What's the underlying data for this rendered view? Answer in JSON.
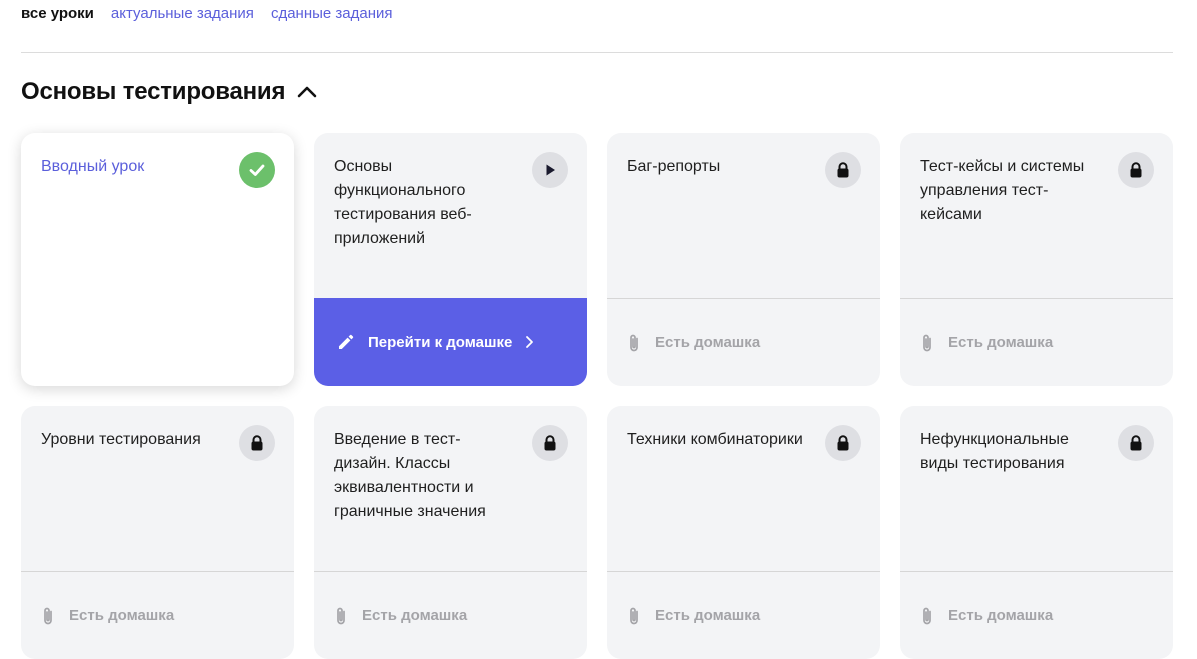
{
  "tabs": [
    {
      "label": "все уроки",
      "active": true
    },
    {
      "label": "актуальные задания",
      "active": false
    },
    {
      "label": "сданные задания",
      "active": false
    }
  ],
  "section": {
    "title": "Основы тестирования",
    "expanded": true
  },
  "lessons": [
    {
      "title": "Вводный урок",
      "status": "completed",
      "status_icon": "check-icon",
      "footer": ""
    },
    {
      "title": "Основы функционального тестирования веб-приложений",
      "status": "current",
      "status_icon": "play-icon",
      "footer": "Перейти к домашке"
    },
    {
      "title": "Баг-репорты",
      "status": "locked",
      "status_icon": "lock-icon",
      "footer": "Есть домашка"
    },
    {
      "title": "Тест-кейсы и системы управления тест-кейсами",
      "status": "locked",
      "status_icon": "lock-icon",
      "footer": "Есть домашка"
    },
    {
      "title": "Уровни тестирования",
      "status": "locked",
      "status_icon": "lock-icon",
      "footer": "Есть домашка"
    },
    {
      "title": "Введение в тест-дизайн. Классы эквивалентности и граничные значения",
      "status": "locked",
      "status_icon": "lock-icon",
      "footer": "Есть домашка"
    },
    {
      "title": "Техники комбинаторики",
      "status": "locked",
      "status_icon": "lock-icon",
      "footer": "Есть домашка"
    },
    {
      "title": "Нефункциональные виды тестирования",
      "status": "locked",
      "status_icon": "lock-icon",
      "footer": "Есть домашка"
    }
  ],
  "colors": {
    "accent": "#5b5fe6",
    "link": "#5b5fdb",
    "success": "#6cc06b",
    "card_bg": "#f3f4f6",
    "muted": "#a4a4a8"
  }
}
